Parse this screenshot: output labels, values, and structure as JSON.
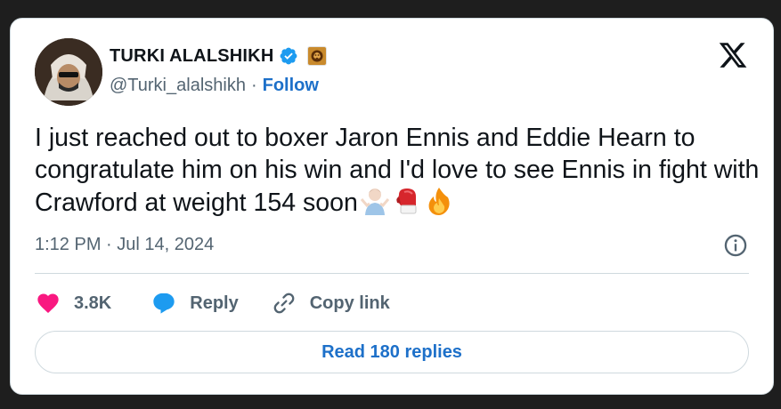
{
  "author": {
    "name": "TURKI ALALSHIKH",
    "handle": "@Turki_alalshikh",
    "separator": "·",
    "follow_label": "Follow"
  },
  "tweet": {
    "text": "I just reached out to boxer Jaron Ennis and Eddie Hearn to congratulate him on his win and I'd love to see Ennis in fight with Crawford at weight 154 soon",
    "emojis": [
      "person-shrugging-emoji",
      "boxing-glove-emoji",
      "fire-emoji"
    ],
    "timestamp": "1:12 PM · Jul 14, 2024"
  },
  "actions": {
    "likes": "3.8K",
    "reply_label": "Reply",
    "copy_link_label": "Copy link"
  },
  "read_replies_label": "Read 180 replies",
  "colors": {
    "background": "#1e1e1e",
    "card": "#ffffff",
    "link_blue": "#1d70c9",
    "verified_blue": "#1d9bf0",
    "like_pink": "#f91880",
    "text": "#0f1419",
    "muted": "#536471",
    "border": "#cfd9de"
  },
  "icons": [
    "verified-badge-icon",
    "affiliate-badge-icon",
    "x-logo-icon",
    "info-icon",
    "heart-icon",
    "reply-bubble-icon",
    "link-icon"
  ]
}
